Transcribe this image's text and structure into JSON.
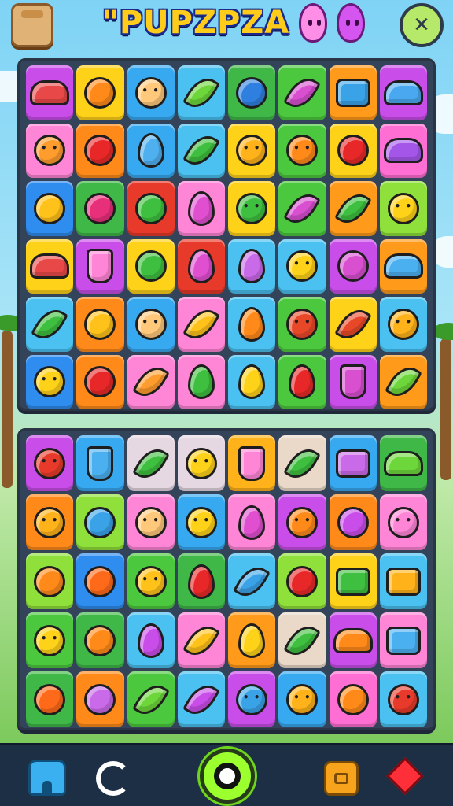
{
  "header": {
    "title": "\"PUPZPZA",
    "bag_icon": "bag-icon",
    "settings_icon": "close-cross-icon",
    "settings_symbol": "✕"
  },
  "colors": {
    "board_frame": "#33445a",
    "nav_bg": "#1c2f44",
    "title_fill": "#ffcc1a",
    "title_outline": "#1b2a8a"
  },
  "top_board": {
    "rows": [
      [
        {
          "bg": "#c94de8",
          "sym": "#e84848",
          "shape": "car",
          "icon": "sunglasses-icon"
        },
        {
          "bg": "#ffd21a",
          "sym": "#ff8a1a",
          "shape": "ball",
          "icon": "orange-icon"
        },
        {
          "bg": "#37a9f0",
          "sym": "#ffc87a",
          "shape": "face",
          "icon": "smiley-face-icon"
        },
        {
          "bg": "#4ac1f0",
          "sym": "#6dd63a",
          "shape": "leaf",
          "icon": "leaf-icon"
        },
        {
          "bg": "#3fb848",
          "sym": "#2f7fe0",
          "shape": "ball",
          "icon": "blue-bomb-icon"
        },
        {
          "bg": "#4cc83e",
          "sym": "#d84fd0",
          "shape": "leaf",
          "icon": "purple-leaf-icon"
        },
        {
          "bg": "#ff9a1a",
          "sym": "#3aa3e8",
          "shape": "box",
          "icon": "book-icon"
        },
        {
          "bg": "#c94de8",
          "sym": "#4aa8f0",
          "shape": "car",
          "icon": "car-icon"
        }
      ],
      [
        {
          "bg": "#ff86d6",
          "sym": "#ff9c2e",
          "shape": "face",
          "icon": "smiley-face-icon"
        },
        {
          "bg": "#ff8a1a",
          "sym": "#e82828",
          "shape": "ball",
          "icon": "apple-icon"
        },
        {
          "bg": "#37a9f0",
          "sym": "#4fb0f0",
          "shape": "drop",
          "icon": "ice-pop-icon"
        },
        {
          "bg": "#4ac1f0",
          "sym": "#3fbf3f",
          "shape": "leaf",
          "icon": "pickle-icon"
        },
        {
          "bg": "#ffd21a",
          "sym": "#ffb21a",
          "shape": "face",
          "icon": "sun-icon"
        },
        {
          "bg": "#4cc83e",
          "sym": "#ff8a1a",
          "shape": "face",
          "icon": "sun-flower-icon"
        },
        {
          "bg": "#ffd21a",
          "sym": "#e82828",
          "shape": "ball",
          "icon": "apple-icon"
        },
        {
          "bg": "#ff6ed2",
          "sym": "#a456e8",
          "shape": "car",
          "icon": "purple-car-icon"
        }
      ],
      [
        {
          "bg": "#2f8df0",
          "sym": "#ffc21a",
          "shape": "ball",
          "icon": "lemon-icon"
        },
        {
          "bg": "#3fb848",
          "sym": "#e8307a",
          "shape": "ball",
          "icon": "cherry-icon"
        },
        {
          "bg": "#e83a2a",
          "sym": "#3fbf3f",
          "shape": "ball",
          "icon": "broccoli-icon"
        },
        {
          "bg": "#ff86d6",
          "sym": "#e04fcf",
          "shape": "drop",
          "icon": "grape-drop-icon"
        },
        {
          "bg": "#ffd21a",
          "sym": "#3fbf3f",
          "shape": "face",
          "icon": "green-blob-icon"
        },
        {
          "bg": "#4cc83e",
          "sym": "#d84fd0",
          "shape": "leaf",
          "icon": "purple-leaf-icon"
        },
        {
          "bg": "#ff9a1a",
          "sym": "#3fbf3f",
          "shape": "leaf",
          "icon": "green-leaf-icon"
        },
        {
          "bg": "#8fe03a",
          "sym": "#ffd21a",
          "shape": "face",
          "icon": "chick-icon"
        }
      ],
      [
        {
          "bg": "#ffd21a",
          "sym": "#e84848",
          "shape": "car",
          "icon": "sunglasses-icon"
        },
        {
          "bg": "#c94de8",
          "sym": "#ff86d6",
          "shape": "crystal",
          "icon": "crystal-icon"
        },
        {
          "bg": "#ffd21a",
          "sym": "#3fbf3f",
          "shape": "ball",
          "icon": "broccoli-icon"
        },
        {
          "bg": "#e83a2a",
          "sym": "#e04fcf",
          "shape": "drop",
          "icon": "grape-drop-icon"
        },
        {
          "bg": "#4ac1f0",
          "sym": "#c96ae8",
          "shape": "drop",
          "icon": "purple-drop-icon"
        },
        {
          "bg": "#4ac1f0",
          "sym": "#ffd21a",
          "shape": "face",
          "icon": "smiley-face-icon"
        },
        {
          "bg": "#c94de8",
          "sym": "#d84fd0",
          "shape": "ball",
          "icon": "plum-icon"
        },
        {
          "bg": "#ff9a1a",
          "sym": "#4ab0f0",
          "shape": "car",
          "icon": "blue-car-icon"
        }
      ],
      [
        {
          "bg": "#4ac1f0",
          "sym": "#3fbf3f",
          "shape": "leaf",
          "icon": "green-leaf-icon"
        },
        {
          "bg": "#ff8a1a",
          "sym": "#ffc21a",
          "shape": "ball",
          "icon": "lemon-icon"
        },
        {
          "bg": "#37a9f0",
          "sym": "#ffc87a",
          "shape": "face",
          "icon": "smiley-face-icon"
        },
        {
          "bg": "#ff86d6",
          "sym": "#ffc21a",
          "shape": "leaf",
          "icon": "yellow-leaf-icon"
        },
        {
          "bg": "#4ac1f0",
          "sym": "#ff8a1a",
          "shape": "drop",
          "icon": "orange-drop-icon"
        },
        {
          "bg": "#4cc83e",
          "sym": "#e84828",
          "shape": "face",
          "icon": "tomato-icon"
        },
        {
          "bg": "#ffd21a",
          "sym": "#e84828",
          "shape": "leaf",
          "icon": "strawberry-icon"
        },
        {
          "bg": "#4ac1f0",
          "sym": "#ffb21a",
          "shape": "face",
          "icon": "yellow-monster-icon"
        }
      ],
      [
        {
          "bg": "#2f8df0",
          "sym": "#ffd21a",
          "shape": "face",
          "icon": "smiley-face-icon"
        },
        {
          "bg": "#ff8a1a",
          "sym": "#e82828",
          "shape": "ball",
          "icon": "apple-icon"
        },
        {
          "bg": "#ff86d6",
          "sym": "#ff9c2e",
          "shape": "leaf",
          "icon": "orange-leaf-icon"
        },
        {
          "bg": "#ff86d6",
          "sym": "#3fbf3f",
          "shape": "drop",
          "icon": "green-pepper-icon"
        },
        {
          "bg": "#4ac1f0",
          "sym": "#ffd21a",
          "shape": "drop",
          "icon": "yellow-drop-icon"
        },
        {
          "bg": "#4cc83e",
          "sym": "#e82828",
          "shape": "drop",
          "icon": "red-drop-icon"
        },
        {
          "bg": "#c94de8",
          "sym": "#d84fd0",
          "shape": "crystal",
          "icon": "crayon-icon"
        },
        {
          "bg": "#ff9a1a",
          "sym": "#6dd63a",
          "shape": "leaf",
          "icon": "palm-leaf-icon"
        }
      ]
    ]
  },
  "bottom_board": {
    "rows": [
      [
        {
          "bg": "#c94de8",
          "sym": "#e83a2a",
          "shape": "face",
          "icon": "red-monster-icon"
        },
        {
          "bg": "#37a9f0",
          "sym": "#4ab0f0",
          "shape": "crystal",
          "icon": "triangle-icon"
        },
        {
          "bg": "#e6d8e2",
          "sym": "#3fbf3f",
          "shape": "leaf",
          "icon": "green-leaf-icon"
        },
        {
          "bg": "#e6d8e2",
          "sym": "#ffd21a",
          "shape": "face",
          "icon": "smiley-face-icon"
        },
        {
          "bg": "#ffb21a",
          "sym": "#ff86d6",
          "shape": "crystal",
          "icon": "cupcake-icon"
        },
        {
          "bg": "#ead9c8",
          "sym": "#3fbf3f",
          "shape": "leaf",
          "icon": "pencil-icon"
        },
        {
          "bg": "#37a9f0",
          "sym": "#c96ae8",
          "shape": "box",
          "icon": "basket-icon"
        },
        {
          "bg": "#3fb848",
          "sym": "#6dd63a",
          "shape": "car",
          "icon": "green-car-icon"
        }
      ],
      [
        {
          "bg": "#ff8a1a",
          "sym": "#ffb21a",
          "shape": "face",
          "icon": "bear-face-icon"
        },
        {
          "bg": "#8fe03a",
          "sym": "#3aa3e8",
          "shape": "ball",
          "icon": "camera-icon"
        },
        {
          "bg": "#ff86d6",
          "sym": "#ffc87a",
          "shape": "face",
          "icon": "smiley-face-icon"
        },
        {
          "bg": "#37a9f0",
          "sym": "#ffd21a",
          "shape": "face",
          "icon": "star-face-icon"
        },
        {
          "bg": "#ff86d6",
          "sym": "#e04fcf",
          "shape": "drop",
          "icon": "grape-drop-icon"
        },
        {
          "bg": "#c94de8",
          "sym": "#ff8a1a",
          "shape": "face",
          "icon": "orange-face-icon"
        },
        {
          "bg": "#ff8a1a",
          "sym": "#c94de8",
          "shape": "ball",
          "icon": "plum-icon"
        },
        {
          "bg": "#ff86d6",
          "sym": "#ff86d6",
          "shape": "face",
          "icon": "pink-monster-icon"
        }
      ],
      [
        {
          "bg": "#8fe03a",
          "sym": "#ff8a1a",
          "shape": "ball",
          "icon": "ball-icon"
        },
        {
          "bg": "#2f8df0",
          "sym": "#ff6a1a",
          "shape": "ball",
          "icon": "orange-icon"
        },
        {
          "bg": "#4cc83e",
          "sym": "#ffc21a",
          "shape": "face",
          "icon": "pineapple-icon"
        },
        {
          "bg": "#3fb848",
          "sym": "#e82828",
          "shape": "drop",
          "icon": "pepper-icon"
        },
        {
          "bg": "#4ac1f0",
          "sym": "#3aa3e8",
          "shape": "leaf",
          "icon": "blue-pencil-icon"
        },
        {
          "bg": "#8fe03a",
          "sym": "#e82828",
          "shape": "ball",
          "icon": "apple-icon"
        },
        {
          "bg": "#ffd21a",
          "sym": "#3fbf3f",
          "shape": "box",
          "icon": "calculator-icon"
        },
        {
          "bg": "#4ac1f0",
          "sym": "#ffb21a",
          "shape": "box",
          "icon": "toolbox-icon"
        }
      ],
      [
        {
          "bg": "#4cc83e",
          "sym": "#ffd21a",
          "shape": "face",
          "icon": "yellow-monster-icon"
        },
        {
          "bg": "#3fb848",
          "sym": "#ff8a1a",
          "shape": "ball",
          "icon": "peach-icon"
        },
        {
          "bg": "#4ac1f0",
          "sym": "#c94de8",
          "shape": "drop",
          "icon": "purple-drop-icon"
        },
        {
          "bg": "#ff86d6",
          "sym": "#ffc21a",
          "shape": "leaf",
          "icon": "yellow-leaf-icon"
        },
        {
          "bg": "#ff9a1a",
          "sym": "#ffd21a",
          "shape": "drop",
          "icon": "yellow-drop-icon"
        },
        {
          "bg": "#ead9c8",
          "sym": "#3fbf3f",
          "shape": "leaf",
          "icon": "green-crayon-icon"
        },
        {
          "bg": "#c94de8",
          "sym": "#ff8a1a",
          "shape": "car",
          "icon": "burger-icon"
        },
        {
          "bg": "#ff86d6",
          "sym": "#4ab0f0",
          "shape": "box",
          "icon": "printer-icon"
        }
      ],
      [
        {
          "bg": "#3fb848",
          "sym": "#ff6a1a",
          "shape": "ball",
          "icon": "orange-icon"
        },
        {
          "bg": "#ff8a1a",
          "sym": "#c96ae8",
          "shape": "ball",
          "icon": "striped-ball-icon"
        },
        {
          "bg": "#4cc83e",
          "sym": "#6dd63a",
          "shape": "leaf",
          "icon": "green-leaf-icon"
        },
        {
          "bg": "#4ac1f0",
          "sym": "#c94de8",
          "shape": "leaf",
          "icon": "purple-crayon-icon"
        },
        {
          "bg": "#c94de8",
          "sym": "#3aa3e8",
          "shape": "face",
          "icon": "blue-monster-icon"
        },
        {
          "bg": "#37a9f0",
          "sym": "#ffb21a",
          "shape": "face",
          "icon": "orange-face-icon"
        },
        {
          "bg": "#ff6ed2",
          "sym": "#ff8a1a",
          "shape": "ball",
          "icon": "ball-icon"
        },
        {
          "bg": "#4ac1f0",
          "sym": "#e83a2a",
          "shape": "face",
          "icon": "red-monster-icon"
        }
      ]
    ]
  },
  "navbar": {
    "items": [
      {
        "icon": "home-icon"
      },
      {
        "icon": "refresh-icon"
      },
      {
        "icon": "play-center-icon"
      },
      {
        "icon": "shop-icon"
      },
      {
        "icon": "gem-icon"
      }
    ]
  }
}
